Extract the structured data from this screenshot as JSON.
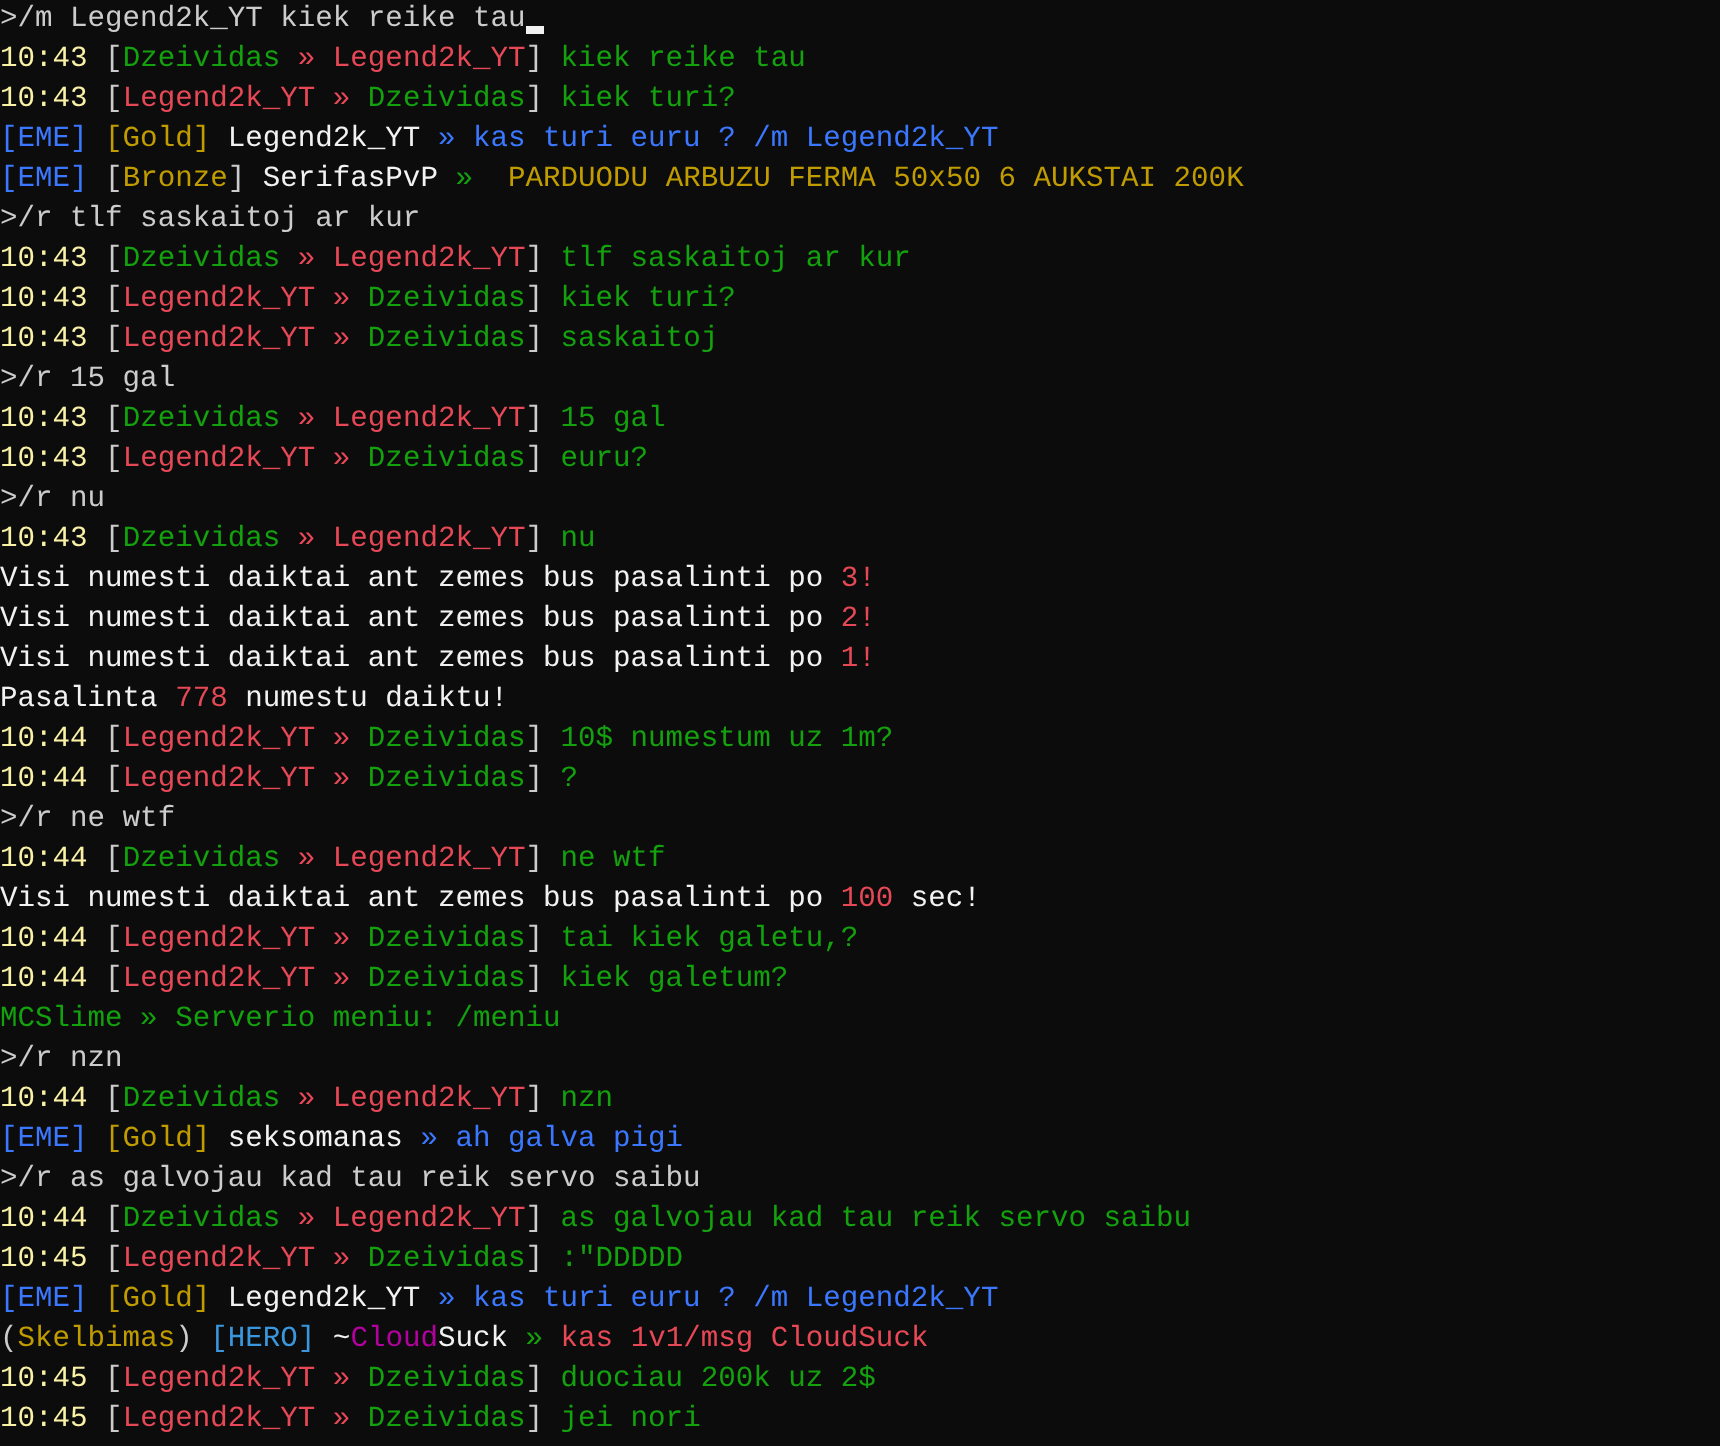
{
  "lines": [
    {
      "cursor": true,
      "segments": [
        {
          "text": ">/m Legend2k_YT kiek reike tau",
          "color": "#cccccc"
        }
      ]
    },
    {
      "segments": [
        {
          "text": "10:43 ",
          "color": "#f9f1a5"
        },
        {
          "text": "[",
          "color": "#cccccc"
        },
        {
          "text": "Dzeividas",
          "color": "#13a10e"
        },
        {
          "text": " » Legend2k_YT",
          "color": "#e74856"
        },
        {
          "text": "] ",
          "color": "#cccccc"
        },
        {
          "text": "kiek reike tau",
          "color": "#13a10e"
        }
      ]
    },
    {
      "segments": [
        {
          "text": "10:43 ",
          "color": "#f9f1a5"
        },
        {
          "text": "[",
          "color": "#cccccc"
        },
        {
          "text": "Legend2k_YT »",
          "color": "#e74856"
        },
        {
          "text": " Dzeividas",
          "color": "#13a10e"
        },
        {
          "text": "] ",
          "color": "#cccccc"
        },
        {
          "text": "kiek turi?",
          "color": "#13a10e"
        }
      ]
    },
    {
      "segments": [
        {
          "text": "[EME] ",
          "color": "#3b78ff"
        },
        {
          "text": "[Gold] ",
          "color": "#c19c00"
        },
        {
          "text": "Legend2k_YT ",
          "color": "#f2f2f2"
        },
        {
          "text": "» kas turi euru ? /m Legend2k_YT",
          "color": "#3b78ff"
        }
      ]
    },
    {
      "segments": [
        {
          "text": "[EME] ",
          "color": "#3b78ff"
        },
        {
          "text": "[",
          "color": "#cccccc"
        },
        {
          "text": "Bronze",
          "color": "#c19c00"
        },
        {
          "text": "] ",
          "color": "#cccccc"
        },
        {
          "text": "SerifasPvP ",
          "color": "#f2f2f2"
        },
        {
          "text": "»  ",
          "color": "#13a10e"
        },
        {
          "text": "PARDUODU ARBUZU FERMA 50x50 6 AUKSTAI 200K",
          "color": "#c19c00"
        }
      ]
    },
    {
      "segments": [
        {
          "text": ">/r tlf saskaitoj ar kur",
          "color": "#cccccc"
        }
      ]
    },
    {
      "segments": [
        {
          "text": "10:43 ",
          "color": "#f9f1a5"
        },
        {
          "text": "[",
          "color": "#cccccc"
        },
        {
          "text": "Dzeividas",
          "color": "#13a10e"
        },
        {
          "text": " » Legend2k_YT",
          "color": "#e74856"
        },
        {
          "text": "] ",
          "color": "#cccccc"
        },
        {
          "text": "tlf saskaitoj ar kur",
          "color": "#13a10e"
        }
      ]
    },
    {
      "segments": [
        {
          "text": "10:43 ",
          "color": "#f9f1a5"
        },
        {
          "text": "[",
          "color": "#cccccc"
        },
        {
          "text": "Legend2k_YT »",
          "color": "#e74856"
        },
        {
          "text": " Dzeividas",
          "color": "#13a10e"
        },
        {
          "text": "] ",
          "color": "#cccccc"
        },
        {
          "text": "kiek turi?",
          "color": "#13a10e"
        }
      ]
    },
    {
      "segments": [
        {
          "text": "10:43 ",
          "color": "#f9f1a5"
        },
        {
          "text": "[",
          "color": "#cccccc"
        },
        {
          "text": "Legend2k_YT »",
          "color": "#e74856"
        },
        {
          "text": " Dzeividas",
          "color": "#13a10e"
        },
        {
          "text": "] ",
          "color": "#cccccc"
        },
        {
          "text": "saskaitoj",
          "color": "#13a10e"
        }
      ]
    },
    {
      "segments": [
        {
          "text": ">/r 15 gal",
          "color": "#cccccc"
        }
      ]
    },
    {
      "segments": [
        {
          "text": "10:43 ",
          "color": "#f9f1a5"
        },
        {
          "text": "[",
          "color": "#cccccc"
        },
        {
          "text": "Dzeividas",
          "color": "#13a10e"
        },
        {
          "text": " » Legend2k_YT",
          "color": "#e74856"
        },
        {
          "text": "] ",
          "color": "#cccccc"
        },
        {
          "text": "15 gal",
          "color": "#13a10e"
        }
      ]
    },
    {
      "segments": [
        {
          "text": "10:43 ",
          "color": "#f9f1a5"
        },
        {
          "text": "[",
          "color": "#cccccc"
        },
        {
          "text": "Legend2k_YT »",
          "color": "#e74856"
        },
        {
          "text": " Dzeividas",
          "color": "#13a10e"
        },
        {
          "text": "] ",
          "color": "#cccccc"
        },
        {
          "text": "euru?",
          "color": "#13a10e"
        }
      ]
    },
    {
      "segments": [
        {
          "text": ">/r nu",
          "color": "#cccccc"
        }
      ]
    },
    {
      "segments": [
        {
          "text": "10:43 ",
          "color": "#f9f1a5"
        },
        {
          "text": "[",
          "color": "#cccccc"
        },
        {
          "text": "Dzeividas",
          "color": "#13a10e"
        },
        {
          "text": " » Legend2k_YT",
          "color": "#e74856"
        },
        {
          "text": "] ",
          "color": "#cccccc"
        },
        {
          "text": "nu",
          "color": "#13a10e"
        }
      ]
    },
    {
      "segments": [
        {
          "text": "Visi numesti daiktai ant zemes bus pasalinti po ",
          "color": "#f2f2f2"
        },
        {
          "text": "3",
          "color": "#e74856"
        },
        {
          "text": "!",
          "color": "#e74856"
        }
      ]
    },
    {
      "segments": [
        {
          "text": "Visi numesti daiktai ant zemes bus pasalinti po ",
          "color": "#f2f2f2"
        },
        {
          "text": "2",
          "color": "#e74856"
        },
        {
          "text": "!",
          "color": "#e74856"
        }
      ]
    },
    {
      "segments": [
        {
          "text": "Visi numesti daiktai ant zemes bus pasalinti po ",
          "color": "#f2f2f2"
        },
        {
          "text": "1",
          "color": "#e74856"
        },
        {
          "text": "!",
          "color": "#e74856"
        }
      ]
    },
    {
      "segments": [
        {
          "text": "Pasalinta ",
          "color": "#f2f2f2"
        },
        {
          "text": "778",
          "color": "#e74856"
        },
        {
          "text": " numestu daiktu!",
          "color": "#f2f2f2"
        }
      ]
    },
    {
      "segments": [
        {
          "text": "10:44 ",
          "color": "#f9f1a5"
        },
        {
          "text": "[",
          "color": "#cccccc"
        },
        {
          "text": "Legend2k_YT »",
          "color": "#e74856"
        },
        {
          "text": " Dzeividas",
          "color": "#13a10e"
        },
        {
          "text": "] ",
          "color": "#cccccc"
        },
        {
          "text": "10$ numestum uz 1m?",
          "color": "#13a10e"
        }
      ]
    },
    {
      "segments": [
        {
          "text": "10:44 ",
          "color": "#f9f1a5"
        },
        {
          "text": "[",
          "color": "#cccccc"
        },
        {
          "text": "Legend2k_YT »",
          "color": "#e74856"
        },
        {
          "text": " Dzeividas",
          "color": "#13a10e"
        },
        {
          "text": "] ",
          "color": "#cccccc"
        },
        {
          "text": "?",
          "color": "#13a10e"
        }
      ]
    },
    {
      "segments": [
        {
          "text": ">/r ne wtf",
          "color": "#cccccc"
        }
      ]
    },
    {
      "segments": [
        {
          "text": "10:44 ",
          "color": "#f9f1a5"
        },
        {
          "text": "[",
          "color": "#cccccc"
        },
        {
          "text": "Dzeividas",
          "color": "#13a10e"
        },
        {
          "text": " » Legend2k_YT",
          "color": "#e74856"
        },
        {
          "text": "] ",
          "color": "#cccccc"
        },
        {
          "text": "ne wtf",
          "color": "#13a10e"
        }
      ]
    },
    {
      "segments": [
        {
          "text": "Visi numesti daiktai ant zemes bus pasalinti po ",
          "color": "#f2f2f2"
        },
        {
          "text": "100",
          "color": "#e74856"
        },
        {
          "text": " sec!",
          "color": "#f2f2f2"
        }
      ]
    },
    {
      "segments": [
        {
          "text": "10:44 ",
          "color": "#f9f1a5"
        },
        {
          "text": "[",
          "color": "#cccccc"
        },
        {
          "text": "Legend2k_YT »",
          "color": "#e74856"
        },
        {
          "text": " Dzeividas",
          "color": "#13a10e"
        },
        {
          "text": "] ",
          "color": "#cccccc"
        },
        {
          "text": "tai kiek galetu,?",
          "color": "#13a10e"
        }
      ]
    },
    {
      "segments": [
        {
          "text": "10:44 ",
          "color": "#f9f1a5"
        },
        {
          "text": "[",
          "color": "#cccccc"
        },
        {
          "text": "Legend2k_YT »",
          "color": "#e74856"
        },
        {
          "text": " Dzeividas",
          "color": "#13a10e"
        },
        {
          "text": "] ",
          "color": "#cccccc"
        },
        {
          "text": "kiek galetum?",
          "color": "#13a10e"
        }
      ]
    },
    {
      "segments": [
        {
          "text": "MCSlime » Serverio meniu: /meniu",
          "color": "#13a10e"
        }
      ]
    },
    {
      "segments": [
        {
          "text": ">/r nzn",
          "color": "#cccccc"
        }
      ]
    },
    {
      "segments": [
        {
          "text": "10:44 ",
          "color": "#f9f1a5"
        },
        {
          "text": "[",
          "color": "#cccccc"
        },
        {
          "text": "Dzeividas",
          "color": "#13a10e"
        },
        {
          "text": " » Legend2k_YT",
          "color": "#e74856"
        },
        {
          "text": "] ",
          "color": "#cccccc"
        },
        {
          "text": "nzn",
          "color": "#13a10e"
        }
      ]
    },
    {
      "segments": [
        {
          "text": "[EME] ",
          "color": "#3b78ff"
        },
        {
          "text": "[Gold] ",
          "color": "#c19c00"
        },
        {
          "text": "seksomanas ",
          "color": "#f2f2f2"
        },
        {
          "text": "» ah galva pigi",
          "color": "#3b78ff"
        }
      ]
    },
    {
      "segments": [
        {
          "text": ">/r as galvojau kad tau reik servo saibu",
          "color": "#cccccc"
        }
      ]
    },
    {
      "segments": [
        {
          "text": "10:44 ",
          "color": "#f9f1a5"
        },
        {
          "text": "[",
          "color": "#cccccc"
        },
        {
          "text": "Dzeividas",
          "color": "#13a10e"
        },
        {
          "text": " » Legend2k_YT",
          "color": "#e74856"
        },
        {
          "text": "] ",
          "color": "#cccccc"
        },
        {
          "text": "as galvojau kad tau reik servo saibu",
          "color": "#13a10e"
        }
      ]
    },
    {
      "segments": [
        {
          "text": "10:45 ",
          "color": "#f9f1a5"
        },
        {
          "text": "[",
          "color": "#cccccc"
        },
        {
          "text": "Legend2k_YT »",
          "color": "#e74856"
        },
        {
          "text": " Dzeividas",
          "color": "#13a10e"
        },
        {
          "text": "] ",
          "color": "#cccccc"
        },
        {
          "text": ":\"DDDDD",
          "color": "#13a10e"
        }
      ]
    },
    {
      "segments": [
        {
          "text": "[EME] ",
          "color": "#3b78ff"
        },
        {
          "text": "[Gold] ",
          "color": "#c19c00"
        },
        {
          "text": "Legend2k_YT ",
          "color": "#f2f2f2"
        },
        {
          "text": "» kas turi euru ? /m Legend2k_YT",
          "color": "#3b78ff"
        }
      ]
    },
    {
      "segments": [
        {
          "text": "(",
          "color": "#cccccc"
        },
        {
          "text": "Skelbimas",
          "color": "#c19c00"
        },
        {
          "text": ") ",
          "color": "#cccccc"
        },
        {
          "text": "[HERO] ",
          "color": "#3a96dd"
        },
        {
          "text": "~",
          "color": "#f2f2f2"
        },
        {
          "text": "Cloud",
          "color": "#b4009e"
        },
        {
          "text": "Suck ",
          "color": "#f2f2f2"
        },
        {
          "text": "» ",
          "color": "#13a10e"
        },
        {
          "text": "kas 1v1/msg CloudSuck",
          "color": "#e74856"
        }
      ]
    },
    {
      "segments": [
        {
          "text": "10:45 ",
          "color": "#f9f1a5"
        },
        {
          "text": "[",
          "color": "#cccccc"
        },
        {
          "text": "Legend2k_YT »",
          "color": "#e74856"
        },
        {
          "text": " Dzeividas",
          "color": "#13a10e"
        },
        {
          "text": "] ",
          "color": "#cccccc"
        },
        {
          "text": "duociau 200k uz 2$",
          "color": "#13a10e"
        }
      ]
    },
    {
      "segments": [
        {
          "text": "10:45 ",
          "color": "#f9f1a5"
        },
        {
          "text": "[",
          "color": "#cccccc"
        },
        {
          "text": "Legend2k_YT »",
          "color": "#e74856"
        },
        {
          "text": " Dzeividas",
          "color": "#13a10e"
        },
        {
          "text": "] ",
          "color": "#cccccc"
        },
        {
          "text": "jei nori",
          "color": "#13a10e"
        }
      ]
    }
  ]
}
